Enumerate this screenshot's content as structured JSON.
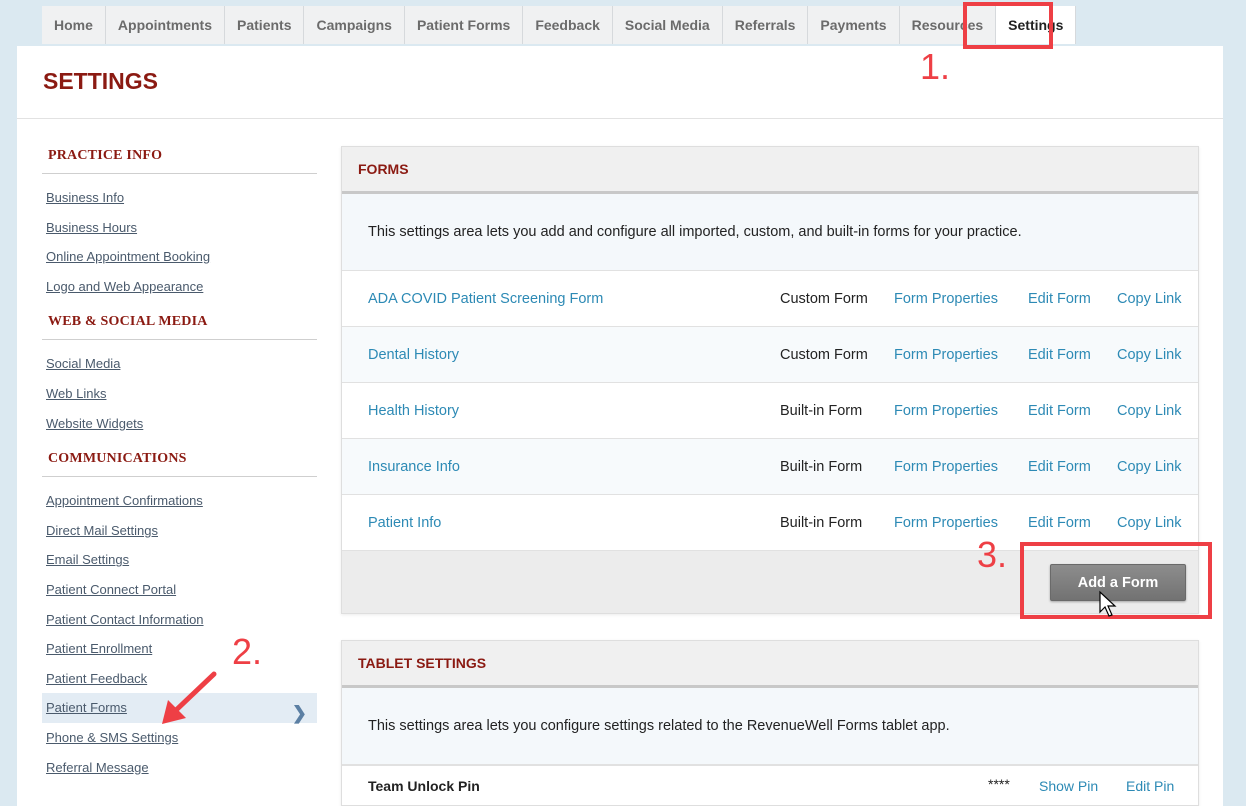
{
  "nav": {
    "tabs": [
      "Home",
      "Appointments",
      "Patients",
      "Campaigns",
      "Patient Forms",
      "Feedback",
      "Social Media",
      "Referrals",
      "Payments",
      "Resources",
      "Settings"
    ],
    "active": "Settings"
  },
  "page": {
    "title": "SETTINGS"
  },
  "annotations": {
    "step1": "1.",
    "step2": "2.",
    "step3": "3."
  },
  "sidebar": {
    "sections": [
      {
        "heading": "PRACTICE INFO",
        "links": [
          "Business Info",
          "Business Hours",
          "Online Appointment Booking",
          "Logo and Web Appearance"
        ]
      },
      {
        "heading": "WEB & SOCIAL MEDIA",
        "links": [
          "Social Media",
          "Web Links",
          "Website Widgets"
        ]
      },
      {
        "heading": "COMMUNICATIONS",
        "links": [
          "Appointment Confirmations",
          "Direct Mail Settings",
          "Email Settings",
          "Patient Connect Portal",
          "Patient Contact Information",
          "Patient Enrollment",
          "Patient Feedback",
          "Patient Forms",
          "Phone & SMS Settings",
          "Referral Message"
        ]
      }
    ],
    "active_link": "Patient Forms"
  },
  "forms": {
    "heading": "FORMS",
    "description": "This settings area lets you add and configure all imported, custom, and built-in forms for your practice.",
    "rows": [
      {
        "name": "ADA COVID Patient Screening Form",
        "type": "Custom Form"
      },
      {
        "name": "Dental History",
        "type": "Custom Form"
      },
      {
        "name": "Health History",
        "type": "Built-in Form"
      },
      {
        "name": "Insurance Info",
        "type": "Built-in Form"
      },
      {
        "name": "Patient Info",
        "type": "Built-in Form"
      }
    ],
    "actions": {
      "properties": "Form Properties",
      "edit": "Edit Form",
      "copy": "Copy Link"
    },
    "add_button": "Add a Form"
  },
  "tablet": {
    "heading": "TABLET SETTINGS",
    "description": "This settings area lets you configure settings related to the RevenueWell Forms tablet app.",
    "pin_label": "Team Unlock Pin",
    "pin_value": "****",
    "show_pin": "Show Pin",
    "edit_pin": "Edit Pin"
  },
  "colors": {
    "heading_red": "#8b1a12",
    "link_blue": "#2d8ab5",
    "annotation_red": "#ee3f45"
  }
}
